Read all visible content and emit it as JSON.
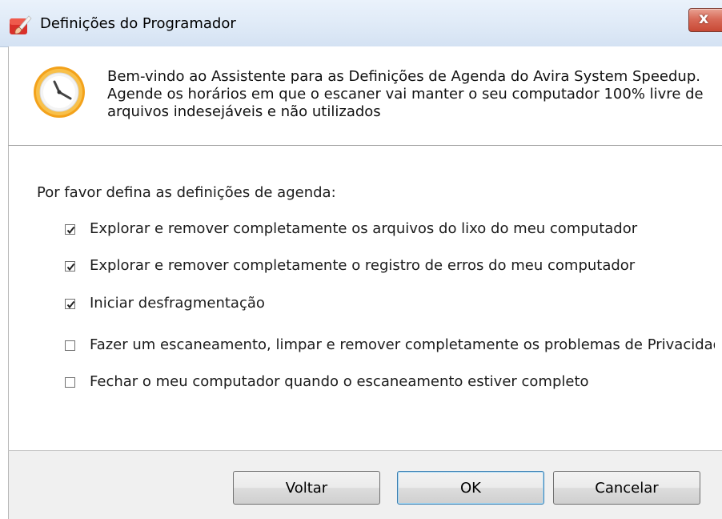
{
  "window": {
    "title": "Definições do Programador",
    "close_label": "x"
  },
  "header": {
    "description": "Bem-vindo ao Assistente para as Definições de Agenda do Avira System Speedup. Agende os horários em que o escaner vai manter o seu computador 100% livre de arquivos indesejáveis e não utilizados",
    "icon": "clock-icon"
  },
  "content": {
    "prompt": "Por favor defina as definições de agenda:",
    "options": [
      {
        "label": "Explorar e remover completamente os arquivos do lixo do meu computador",
        "checked": true
      },
      {
        "label": "Explorar e remover completamente o registro de erros do meu computador",
        "checked": true
      },
      {
        "label": "Iniciar desfragmentação",
        "checked": true
      },
      {
        "label": "Fazer um escaneamento, limpar e remover completamente os problemas de Privacidade",
        "checked": false
      },
      {
        "label": "Fechar o meu computador quando o escaneamento estiver completo",
        "checked": false
      }
    ]
  },
  "footer": {
    "back_label": "Voltar",
    "ok_label": "OK",
    "cancel_label": "Cancelar"
  },
  "colors": {
    "titlebar": "#dfeaf7",
    "close_button": "#d86b59",
    "footer": "#f0f0f0",
    "default_button_border": "#3c7fb1",
    "clock_ring": "#f3a21b"
  }
}
